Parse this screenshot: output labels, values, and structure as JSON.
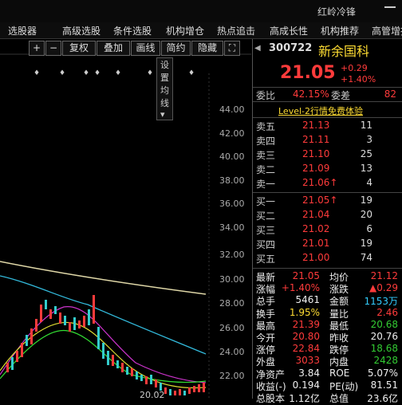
{
  "topbar": {
    "right_text": "红岭冷锋"
  },
  "menu": [
    "选股器",
    "高级选股",
    "条件选股",
    "机构增仓",
    "热点追击",
    "高成长性",
    "机构推荐",
    "高管增持"
  ],
  "toolbar": {
    "buttons": [
      "+",
      "−",
      "复权",
      "叠加",
      "画线",
      "简约",
      "隐藏"
    ],
    "dropdown_label": "设置均线"
  },
  "chart": {
    "y_ticks": [
      "44.00",
      "42.00",
      "40.00",
      "38.00",
      "36.00",
      "34.00",
      "32.00",
      "30.00",
      "28.00",
      "26.00",
      "24.00",
      "22.00"
    ],
    "low_label": "20.02",
    "marker_glyph": "♦"
  },
  "quote": {
    "code": "300722",
    "name": "新余国科",
    "price": "21.05",
    "change": "+0.29",
    "change_pct": "+1.40%",
    "weibi_label": "委比",
    "weibi_value": "42.15%",
    "weicha_label": "委差",
    "weicha_value": "82",
    "level2_banner": "Level-2行情免费体验"
  },
  "orderbook": {
    "asks": [
      {
        "label": "卖五",
        "price": "21.13",
        "vol": "11"
      },
      {
        "label": "卖四",
        "price": "21.11",
        "vol": "3"
      },
      {
        "label": "卖三",
        "price": "21.10",
        "vol": "25"
      },
      {
        "label": "卖二",
        "price": "21.09",
        "vol": "13"
      },
      {
        "label": "卖一",
        "price": "21.06↑",
        "vol": "4"
      }
    ],
    "bids": [
      {
        "label": "买一",
        "price": "21.05↑",
        "vol": "19"
      },
      {
        "label": "买二",
        "price": "21.04",
        "vol": "20"
      },
      {
        "label": "买三",
        "price": "21.02",
        "vol": "6"
      },
      {
        "label": "买四",
        "price": "21.01",
        "vol": "19"
      },
      {
        "label": "买五",
        "price": "21.00",
        "vol": "74"
      }
    ]
  },
  "stats": [
    [
      "最新",
      "21.05",
      "red",
      "均价",
      "21.12",
      "red"
    ],
    [
      "涨幅",
      "+1.40%",
      "red",
      "涨跌",
      "▲0.29",
      "red"
    ],
    [
      "总手",
      "5461",
      "white",
      "金额",
      "1153万",
      "cyan"
    ],
    [
      "换手",
      "1.95%",
      "yellow",
      "量比",
      "2.46",
      "red"
    ],
    [
      "最高",
      "21.39",
      "red",
      "最低",
      "20.68",
      "green"
    ],
    [
      "今开",
      "20.80",
      "red",
      "昨收",
      "20.76",
      "white"
    ],
    [
      "涨停",
      "22.84",
      "red",
      "跌停",
      "18.68",
      "green"
    ],
    [
      "外盘",
      "3033",
      "red",
      "内盘",
      "2428",
      "green"
    ],
    [
      "净资产",
      "3.84",
      "white",
      "ROE",
      "5.07%",
      "white"
    ],
    [
      "收益(-)",
      "0.194",
      "white",
      "PE(动)",
      "81.51",
      "white"
    ],
    [
      "总股本",
      "1.12亿",
      "white",
      "总值",
      "23.6亿",
      "white"
    ]
  ]
}
